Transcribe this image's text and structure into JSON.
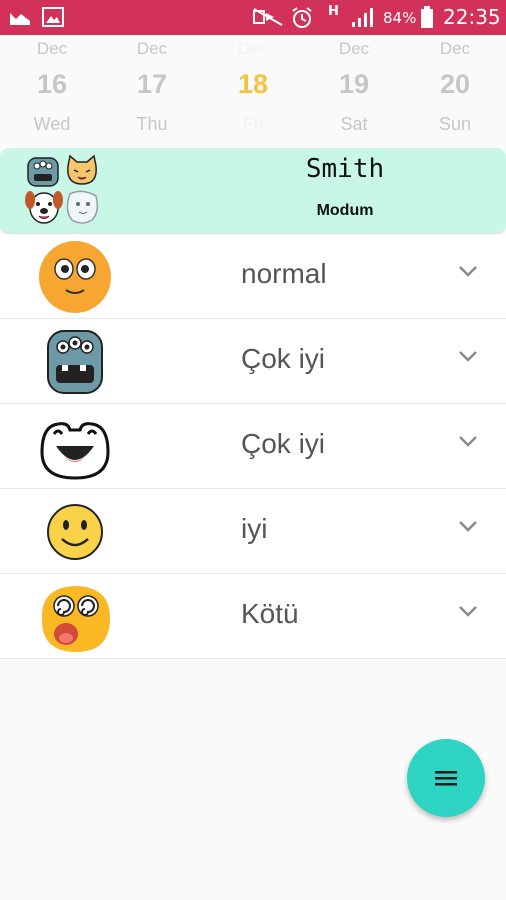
{
  "status_bar": {
    "battery_percent": "84%",
    "time": "22:35",
    "network_type": "H",
    "icons": [
      "gallery-icon",
      "image-icon",
      "mute-icon",
      "alarm-icon",
      "signal-icon",
      "battery-icon"
    ]
  },
  "calendar": {
    "days": [
      {
        "month": "Dec",
        "day": "16",
        "weekday": "Wed"
      },
      {
        "month": "Dec",
        "day": "17",
        "weekday": "Thu"
      },
      {
        "month": "Dec",
        "day": "18",
        "weekday": "Fri"
      },
      {
        "month": "Dec",
        "day": "19",
        "weekday": "Sat"
      },
      {
        "month": "Dec",
        "day": "20",
        "weekday": "Sun"
      }
    ],
    "selected_index": 2
  },
  "header": {
    "name": "Smith",
    "subtitle": "Modum"
  },
  "moods": [
    {
      "label": "normal",
      "icon": "orange-face-icon"
    },
    {
      "label": "Çok iyi",
      "icon": "monster-face-icon"
    },
    {
      "label": "Çok iyi",
      "icon": "frog-face-icon"
    },
    {
      "label": "iyi",
      "icon": "smiley-face-icon"
    },
    {
      "label": "Kötü",
      "icon": "dizzy-face-icon"
    }
  ],
  "fab": {
    "icon": "menu-icon"
  },
  "colors": {
    "status_bar": "#d2325a",
    "header_card": "#c8f7e7",
    "selected_day": "#f5c342",
    "fab": "#2dd4c3"
  }
}
